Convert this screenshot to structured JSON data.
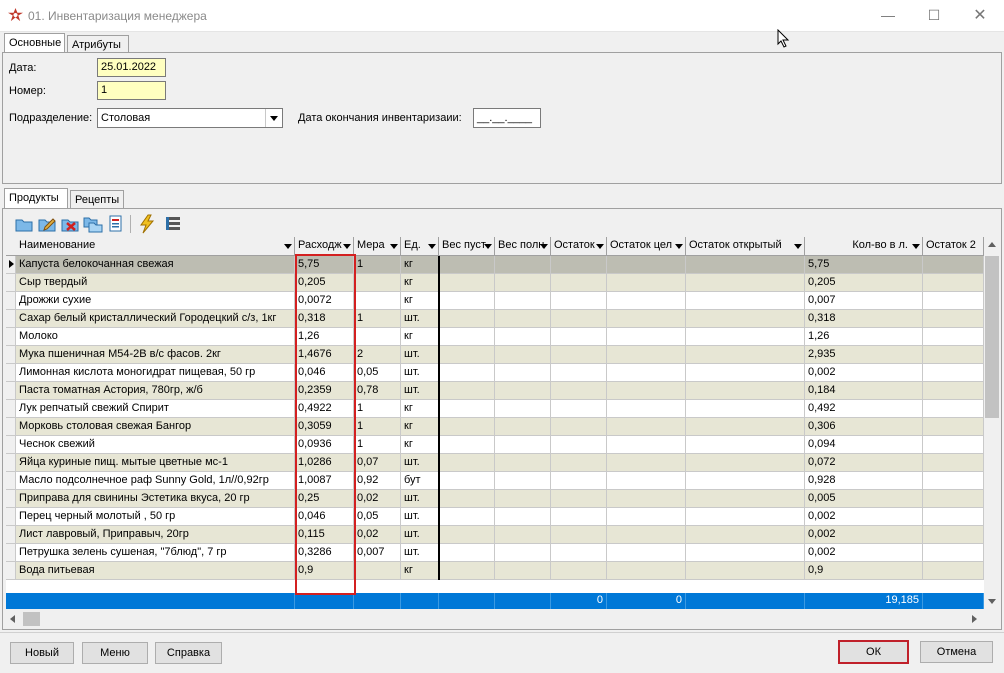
{
  "window": {
    "title": "01. Инвентаризация менеджера"
  },
  "top_tabs": [
    {
      "label": "Основные"
    },
    {
      "label": "Атрибуты"
    }
  ],
  "form": {
    "date_label": "Дата:",
    "date_value": "25.01.2022",
    "number_label": "Номер:",
    "number_value": "1",
    "department_label": "Подразделение:",
    "department_value": "Столовая",
    "end_date_label": "Дата окончания инвентаризаии:",
    "end_date_value": "__.__.____"
  },
  "bottom_tabs": [
    {
      "label": "Продукты"
    },
    {
      "label": "Рецепты"
    }
  ],
  "toolbar": [
    "folder-open-icon",
    "edit-icon",
    "delete-icon",
    "copy-icon",
    "document-icon",
    "lightning-icon",
    "list-icon"
  ],
  "grid": {
    "headers": [
      "Наименование",
      "Расходж",
      "Мера",
      "Ед.",
      "Вес пуст",
      "Вес полн",
      "Остаток",
      "Остаток цел",
      "Остаток открытый",
      "Кол-во в л.",
      "Остаток 2"
    ],
    "rows": [
      [
        "Капуста белокочанная свежая",
        "5,75",
        "1",
        "кг",
        "5,75"
      ],
      [
        "Сыр твердый",
        "0,205",
        "",
        "кг",
        "0,205"
      ],
      [
        "Дрожжи сухие",
        "0,0072",
        "",
        "кг",
        "0,007"
      ],
      [
        "Сахар белый кристаллический Городецкий с/з, 1кг",
        "0,318",
        "1",
        "шт.",
        "0,318"
      ],
      [
        "Молоко",
        "1,26",
        "",
        "кг",
        "1,26"
      ],
      [
        "Мука пшеничная М54-2В в/с фасов. 2кг",
        "1,4676",
        "2",
        "шт.",
        "2,935"
      ],
      [
        "Лимонная кислота моногидрат пищевая, 50 гр",
        "0,046",
        "0,05",
        "шт.",
        "0,002"
      ],
      [
        "Паста томатная Астория, 780гр, ж/б",
        "0,2359",
        "0,78",
        "шт.",
        "0,184"
      ],
      [
        "Лук репчатый свежий Спирит",
        "0,4922",
        "1",
        "кг",
        "0,492"
      ],
      [
        "Морковь столовая свежая Бангор",
        "0,3059",
        "1",
        "кг",
        "0,306"
      ],
      [
        "Чеснок свежий",
        "0,0936",
        "1",
        "кг",
        "0,094"
      ],
      [
        "Яйца куриные пищ. мытые цветные мс-1",
        "1,0286",
        "0,07",
        "шт.",
        "0,072"
      ],
      [
        "Масло подсолнечное раф Sunny Gold, 1л//0,92гр",
        "1,0087",
        "0,92",
        "бут",
        "0,928"
      ],
      [
        "Приправа для свинины Эстетика вкуса, 20 гр",
        "0,25",
        "0,02",
        "шт.",
        "0,005"
      ],
      [
        "Перец черный молотый , 50 гр",
        "0,046",
        "0,05",
        "шт.",
        "0,002"
      ],
      [
        "Лист лавровый, Приправыч, 20гр",
        "0,115",
        "0,02",
        "шт.",
        "0,002"
      ],
      [
        "Петрушка зелень сушеная, \"7блюд\", 7 гр",
        "0,3286",
        "0,007",
        "шт.",
        "0,002"
      ],
      [
        "Вода питьевая",
        "0,9",
        "",
        "кг",
        "0,9"
      ]
    ],
    "totals": {
      "ostatok_cel": "0",
      "ostatok_otkr": "0",
      "kolvo": "19,185"
    }
  },
  "buttons": {
    "new": "Новый",
    "menu": "Меню",
    "help": "Справка",
    "ok": "ОК",
    "cancel": "Отмена"
  }
}
